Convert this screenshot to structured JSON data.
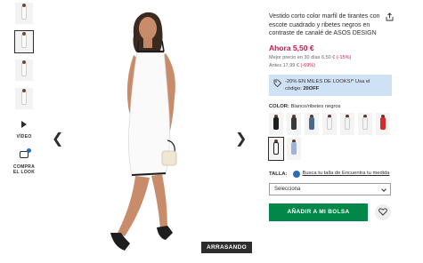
{
  "gallery": {
    "video_label": "VÍDEO",
    "look_label_line1": "COMPRA",
    "look_label_line2": "EL LOOK",
    "badge": "ARRASANDO"
  },
  "product": {
    "title": "Vestido corto color marfil de tirantes con escote cuadrado y ribetes negros en contraste de canalé de ASOS DESIGN",
    "price_now": "Ahora 5,50 €",
    "best_price_text": "Mejor precio en 30 días 6,50 € ",
    "best_price_discount": "(-15%)",
    "before_text": "Antes 17,99 € ",
    "before_discount": "(-69%)"
  },
  "promo": {
    "text_prefix": "-20% EN MILES DE LOOKS!* Usa el código: ",
    "code": "20OFF"
  },
  "color": {
    "label": "COLOR:",
    "value": " Blanco/ribetes negros"
  },
  "size": {
    "label": "TALLA:",
    "fit_link": "Busca tu talla de Encuentra tu medida",
    "select_value": "Selecciona"
  },
  "actions": {
    "add_to_bag": "AÑADIR A MI BOLSA"
  },
  "colors": {
    "accent_green": "#018849",
    "price_red": "#d01345",
    "promo_bg": "#cfe1f5"
  }
}
